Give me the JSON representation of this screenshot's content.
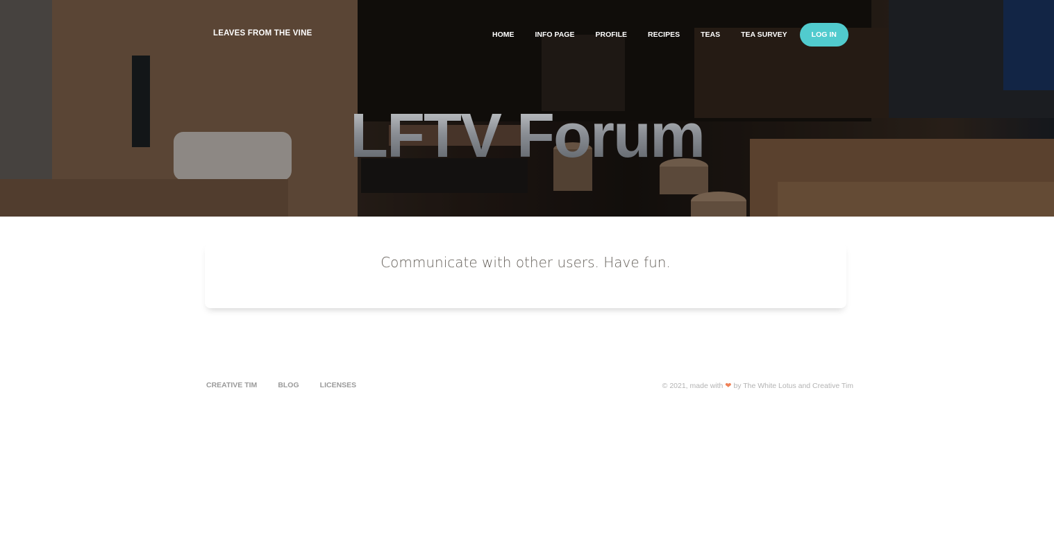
{
  "header": {
    "brand": "LEAVES FROM THE VINE",
    "nav": [
      "HOME",
      "INFO PAGE",
      "PROFILE",
      "RECIPES",
      "TEAS",
      "TEA SURVEY"
    ],
    "login_label": "LOG IN",
    "accent_color": "#51cbce"
  },
  "hero": {
    "title": "LFTV Forum"
  },
  "card": {
    "text": "Communicate with other users. Have fun."
  },
  "footer": {
    "links": [
      "CREATIVE TIM",
      "BLOG",
      "LICENSES"
    ],
    "copyright_prefix": "© 2021, made with",
    "heart_icon": "heart-icon",
    "copyright_suffix": "by The White Lotus and Creative Tim"
  }
}
